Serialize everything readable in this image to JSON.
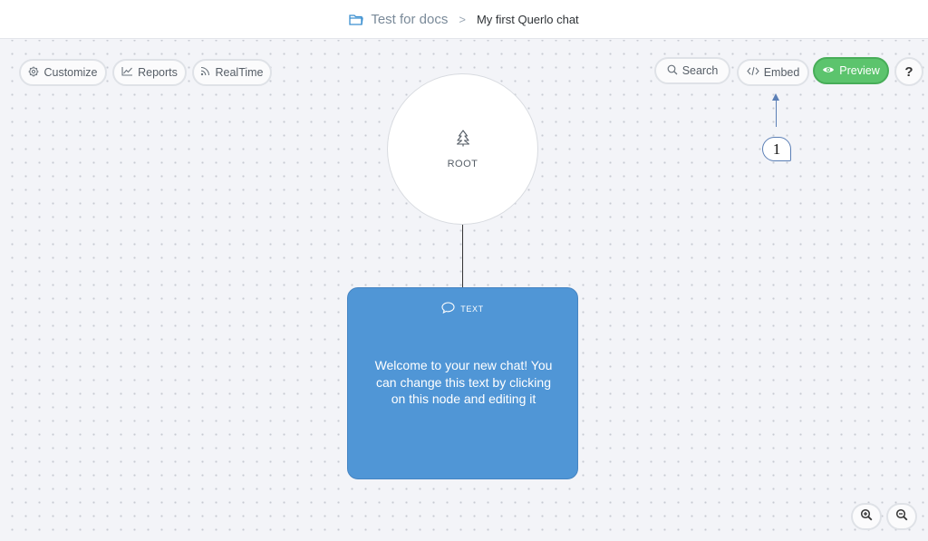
{
  "header": {
    "project": "Test for docs",
    "separator": ">",
    "chat_name": "My first Querlo chat"
  },
  "toolbar_left": {
    "customize": "Customize",
    "reports": "Reports",
    "realtime": "RealTime"
  },
  "toolbar_right": {
    "search": "Search",
    "embed": "Embed",
    "preview": "Preview",
    "help": "?"
  },
  "root_node": {
    "label": "ROOT"
  },
  "text_node": {
    "type": "TEXT",
    "body": "Welcome to your new chat! You can change this text by clicking on this node and editing it"
  },
  "annotation": {
    "number": "1"
  },
  "colors": {
    "preview_green": "#5cc46d",
    "node_blue": "#5096d6",
    "annotation_blue": "#5b7fb6",
    "folder_blue": "#3a8fd0"
  },
  "icons": {
    "folder": "folder-icon",
    "customize": "gear-icon",
    "reports": "chart-icon",
    "realtime": "rss-icon",
    "search": "search-icon",
    "embed": "code-icon",
    "preview": "eye-icon",
    "root": "tree-icon",
    "text": "speech-bubble-icon",
    "zoom_in": "zoom-in-icon",
    "zoom_out": "zoom-out-icon"
  }
}
